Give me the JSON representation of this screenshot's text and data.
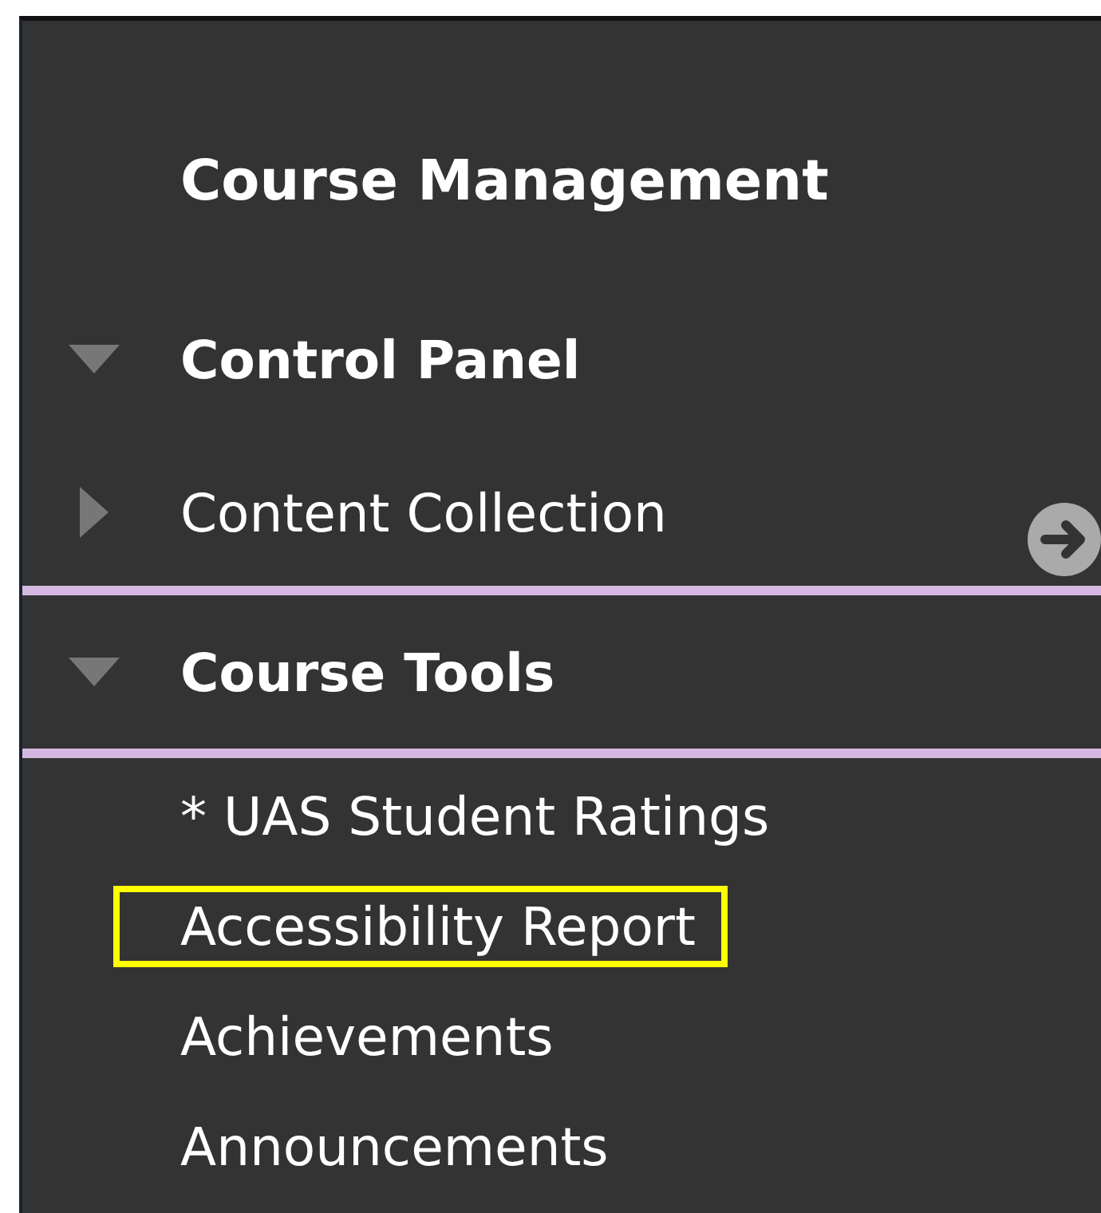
{
  "title": "Course Management",
  "menu": [
    {
      "label": "Control Panel",
      "kind": "section",
      "expanded": true
    },
    {
      "label": "Content Collection",
      "kind": "link",
      "expanded": false
    },
    {
      "label": "Course Tools",
      "kind": "section",
      "expanded": true
    }
  ],
  "tools": [
    {
      "label": "* UAS Student Ratings",
      "highlighted": false
    },
    {
      "label": "Accessibility Report",
      "highlighted": true
    },
    {
      "label": "Achievements",
      "highlighted": false
    },
    {
      "label": "Announcements",
      "highlighted": false
    }
  ]
}
